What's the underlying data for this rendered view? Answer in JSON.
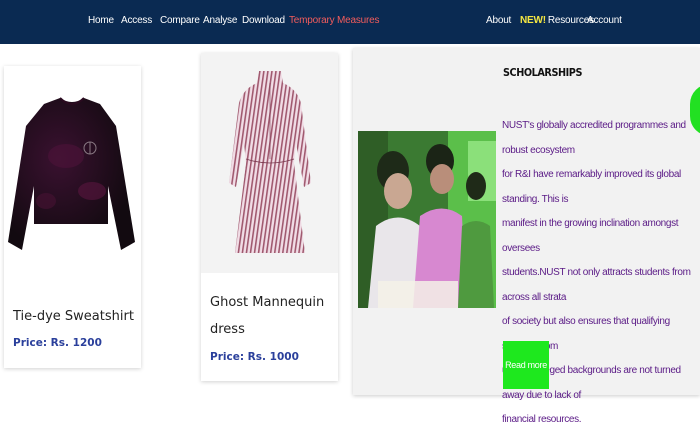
{
  "nav": {
    "left": [
      "Home",
      "Access",
      "Compare",
      "Analyse",
      "Download",
      "Temporary Measures"
    ],
    "about": "About",
    "new_badge": "NEW!",
    "resources": "Resources",
    "account": "Account"
  },
  "products": [
    {
      "title": "Tie-dye Sweatshirt",
      "price": "Price: Rs. 1200"
    },
    {
      "title_line1": "Ghost Mannequin",
      "title_line2": "dress",
      "price": "Price: Rs. 1000"
    }
  ],
  "scholarships": {
    "title": "SCHOLARSHIPS",
    "lines": [
      "NUST's globally accredited programmes and robust ecosystem",
      "for R&I have remarkably improved its global standing. This is",
      "manifest in the growing inclination amongst oversees",
      "students.NUST not only attracts students from across all strata",
      "of society but also ensures that qualifying students from",
      "underprivileged backgrounds are not turned away due to lack of",
      "financial resources."
    ],
    "button": "Read more"
  },
  "colors": {
    "navbar": "#0a2a52",
    "temporary_measures": "#f25c5c",
    "new_badge": "#f4e642",
    "price": "#2a3f9b",
    "scholarship_text": "#5a1a86",
    "read_more": "#1ee81e"
  }
}
